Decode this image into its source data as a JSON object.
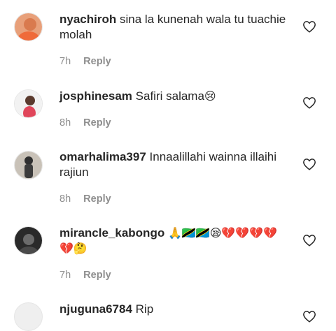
{
  "comments": [
    {
      "username": "nyachiroh",
      "text": "sina la kunenah wala tu tuachie molah",
      "time": "7h",
      "reply": "Reply"
    },
    {
      "username": "josphinesam",
      "text": "Safiri salama",
      "emoji": "😢",
      "time": "8h",
      "reply": "Reply"
    },
    {
      "username": "omarhalima397",
      "text": "Innaalillahi wainna illaihi rajiun",
      "time": "8h",
      "reply": "Reply"
    },
    {
      "username": "mirancle_kabongo",
      "text": "🙏🇹🇿🇹🇿😪💔💔💔💔",
      "text2": "💔🤔",
      "time": "7h",
      "reply": "Reply"
    },
    {
      "username": "njuguna6784",
      "text": "Rip"
    }
  ],
  "icons": {
    "like": "heart-outline-icon"
  }
}
